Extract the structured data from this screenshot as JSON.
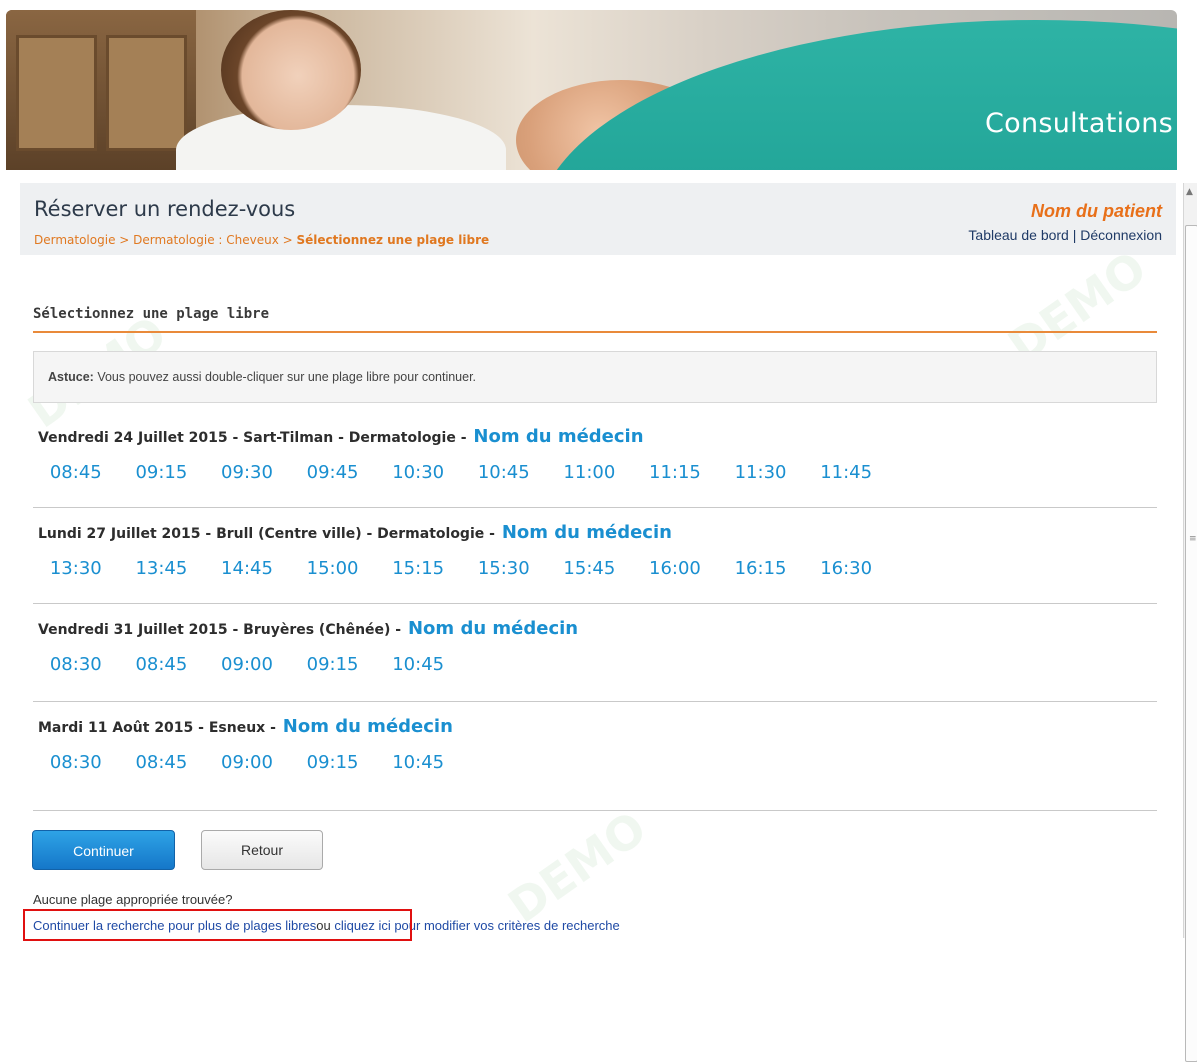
{
  "banner": {
    "title": "Consultations"
  },
  "header": {
    "title": "Réserver un rendez-vous",
    "breadcrumb": {
      "part1": "Dermatologie",
      "sep": " > ",
      "part2": "Dermatologie : Cheveux",
      "current": "Sélectionnez une plage libre"
    },
    "patient_name": "Nom du patient",
    "dashboard_link": "Tableau de bord",
    "link_sep": " | ",
    "logout_link": "Déconnexion"
  },
  "section": {
    "title": "Sélectionnez une plage libre",
    "tip_label": "Astuce:",
    "tip_text": " Vous pouvez aussi double-cliquer sur une plage libre pour continuer."
  },
  "days": [
    {
      "label": "Vendredi 24 Juillet 2015 - Sart-Tilman - Dermatologie - ",
      "doctor": "Nom du médecin",
      "slots": [
        "08:45",
        "09:15",
        "09:30",
        "09:45",
        "10:30",
        "10:45",
        "11:00",
        "11:15",
        "11:30",
        "11:45"
      ]
    },
    {
      "label": "Lundi 27 Juillet 2015 - Brull (Centre ville) -  Dermatologie - ",
      "doctor": "Nom du médecin",
      "slots": [
        "13:30",
        "13:45",
        "14:45",
        "15:00",
        "15:15",
        "15:30",
        "15:45",
        "16:00",
        "16:15",
        "16:30"
      ]
    },
    {
      "label": "Vendredi 31 Juillet 2015 - Bruyères (Chênée) - ",
      "doctor": "Nom du médecin",
      "slots": [
        "08:30",
        "08:45",
        "09:00",
        "09:15",
        "10:45"
      ]
    },
    {
      "label": "Mardi 11 Août 2015 - Esneux - ",
      "doctor": "Nom du médecin",
      "slots": [
        "08:30",
        "08:45",
        "09:00",
        "09:15",
        "10:45"
      ]
    }
  ],
  "buttons": {
    "continue": "Continuer",
    "back": "Retour"
  },
  "footer": {
    "no_slot": "Aucune plage appropriée trouvée?",
    "more_link": "Continuer la recherche pour plus de plages libres",
    "or_text": "ou ",
    "modify_link": "cliquez ici pour modifier vos critères de recherche"
  },
  "watermark": "DEMO"
}
